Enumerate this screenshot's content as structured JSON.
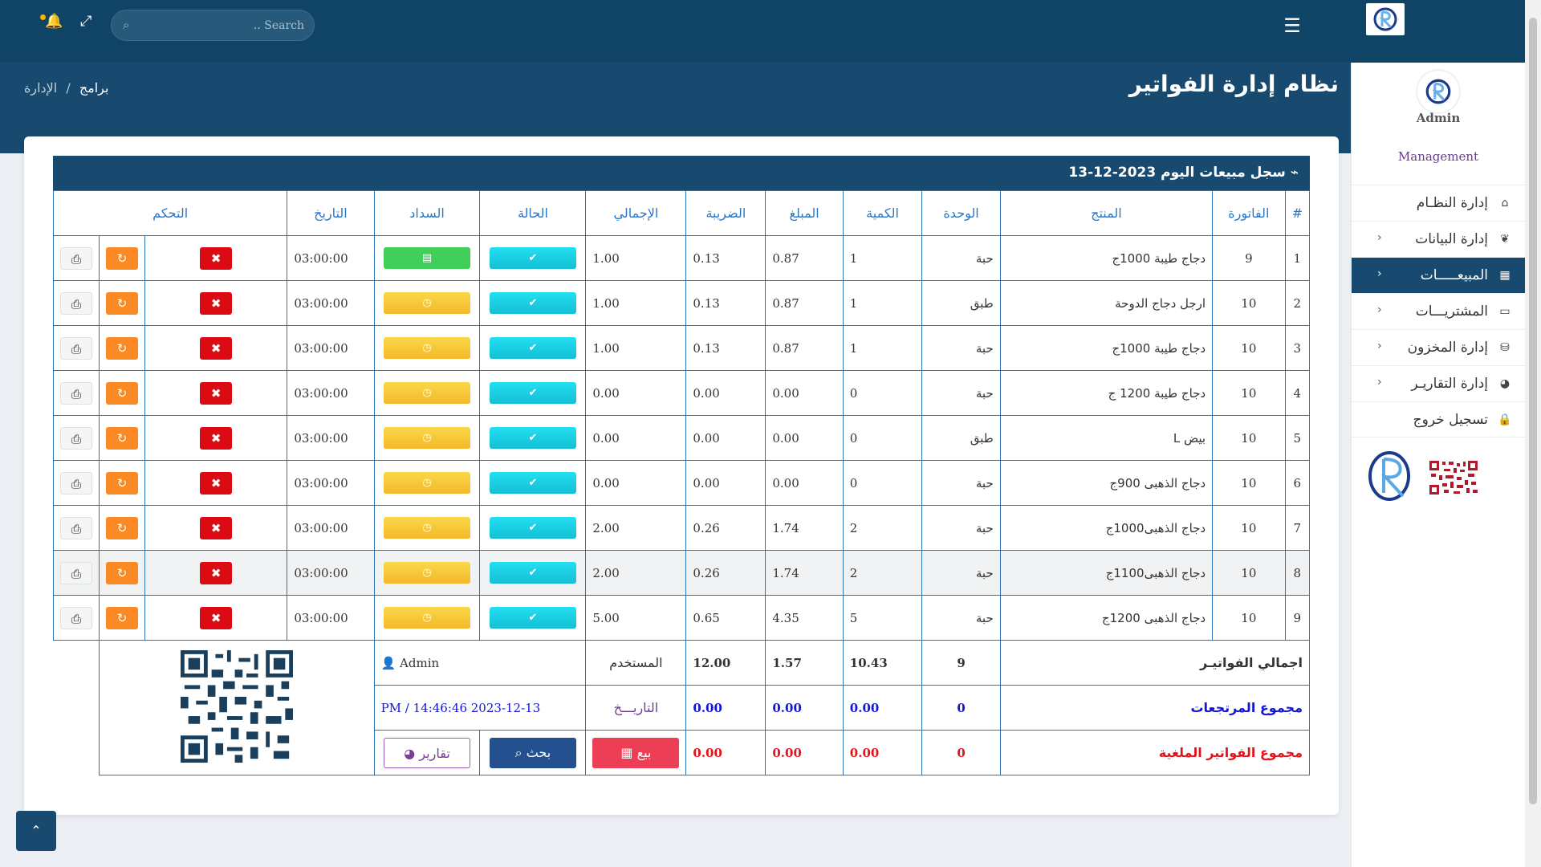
{
  "topbar": {
    "search_placeholder": ".. Search"
  },
  "header": {
    "title": "نظام إدارة الفواتير",
    "breadcrumb_current": "برامج",
    "breadcrumb_sep": "/",
    "breadcrumb_parent": "الإدارة"
  },
  "sidebar": {
    "user": "Admin",
    "role": "Management",
    "items": [
      {
        "label": "إدارة النظـام",
        "icon": "home-icon"
      },
      {
        "label": "إدارة البيانات",
        "icon": "leaf-icon"
      },
      {
        "label": "المبيعـــــات",
        "icon": "qrcode-icon"
      },
      {
        "label": "المشتريـــات",
        "icon": "desktop-icon"
      },
      {
        "label": "إدارة المخزون",
        "icon": "cubes-icon"
      },
      {
        "label": "إدارة التقاريـر",
        "icon": "pie-chart-icon"
      },
      {
        "label": "تسجيل خروج",
        "icon": "lock-icon"
      }
    ]
  },
  "table": {
    "title": "سجل مبيعات اليوم 2023-12-13",
    "headers": {
      "idx": "#",
      "invoice": "الفاتورة",
      "product": "المنتج",
      "unit": "الوحدة",
      "qty": "الكمية",
      "amount": "المبلغ",
      "tax": "الضريبة",
      "total": "الإجمالي",
      "status": "الحالة",
      "payment": "السداد",
      "date": "التاريخ",
      "control": "التحكم"
    },
    "rows": [
      {
        "idx": "1",
        "invoice": "9",
        "product": "دجاج طيبة 1000ج",
        "unit": "حبة",
        "qty": "1",
        "amount": "0.87",
        "tax": "0.13",
        "total": "1.00",
        "payment": "cash",
        "time": "03:00:00"
      },
      {
        "idx": "2",
        "invoice": "10",
        "product": "ارجل دجاج الدوحة",
        "unit": "طبق",
        "qty": "1",
        "amount": "0.87",
        "tax": "0.13",
        "total": "1.00",
        "payment": "pending",
        "time": "03:00:00"
      },
      {
        "idx": "3",
        "invoice": "10",
        "product": "دجاج طيبة 1000ج",
        "unit": "حبة",
        "qty": "1",
        "amount": "0.87",
        "tax": "0.13",
        "total": "1.00",
        "payment": "pending",
        "time": "03:00:00"
      },
      {
        "idx": "4",
        "invoice": "10",
        "product": "دجاج طيبة 1200 ج",
        "unit": "حبة",
        "qty": "0",
        "amount": "0.00",
        "tax": "0.00",
        "total": "0.00",
        "payment": "pending",
        "time": "03:00:00"
      },
      {
        "idx": "5",
        "invoice": "10",
        "product": "بيض L",
        "unit": "طبق",
        "qty": "0",
        "amount": "0.00",
        "tax": "0.00",
        "total": "0.00",
        "payment": "pending",
        "time": "03:00:00"
      },
      {
        "idx": "6",
        "invoice": "10",
        "product": "دجاج الذهبى 900ج",
        "unit": "حبة",
        "qty": "0",
        "amount": "0.00",
        "tax": "0.00",
        "total": "0.00",
        "payment": "pending",
        "time": "03:00:00"
      },
      {
        "idx": "7",
        "invoice": "10",
        "product": "دجاج الذهبى1000ج",
        "unit": "حبة",
        "qty": "2",
        "amount": "1.74",
        "tax": "0.26",
        "total": "2.00",
        "payment": "pending",
        "time": "03:00:00"
      },
      {
        "idx": "8",
        "invoice": "10",
        "product": "دجاج الذهبى1100ج",
        "unit": "حبة",
        "qty": "2",
        "amount": "1.74",
        "tax": "0.26",
        "total": "2.00",
        "payment": "pending",
        "time": "03:00:00"
      },
      {
        "idx": "9",
        "invoice": "10",
        "product": "دجاج الذهبى 1200ج",
        "unit": "حبة",
        "qty": "5",
        "amount": "4.35",
        "tax": "0.65",
        "total": "5.00",
        "payment": "pending",
        "time": "03:00:00"
      }
    ],
    "summary": {
      "invoices": {
        "label": "اجمالي الفواتيـر",
        "qty": "9",
        "amount": "10.43",
        "tax": "1.57",
        "total": "12.00",
        "user_label": "المستخدم",
        "user_value": "Admin"
      },
      "returns": {
        "label": "مجموع المرتجعات",
        "qty": "0",
        "amount": "0.00",
        "tax": "0.00",
        "total": "0.00",
        "date_label": "التاريـــخ",
        "date_value": "PM / 14:46:46 2023-12-13"
      },
      "cancelled": {
        "label": "مجموع الفواتير الملغية",
        "qty": "0",
        "amount": "0.00",
        "tax": "0.00",
        "total": "0.00"
      }
    },
    "buttons": {
      "sell": "بيع",
      "search": "بحث",
      "reports": "تقارير"
    }
  },
  "colors": {
    "navy": "#174a6e",
    "accent_cyan": "#14bfd6",
    "pending_yellow": "#f3b82a",
    "paid_green": "#3fcf5a",
    "delete_red": "#dc0a13",
    "undo_orange": "#fb8a24"
  }
}
